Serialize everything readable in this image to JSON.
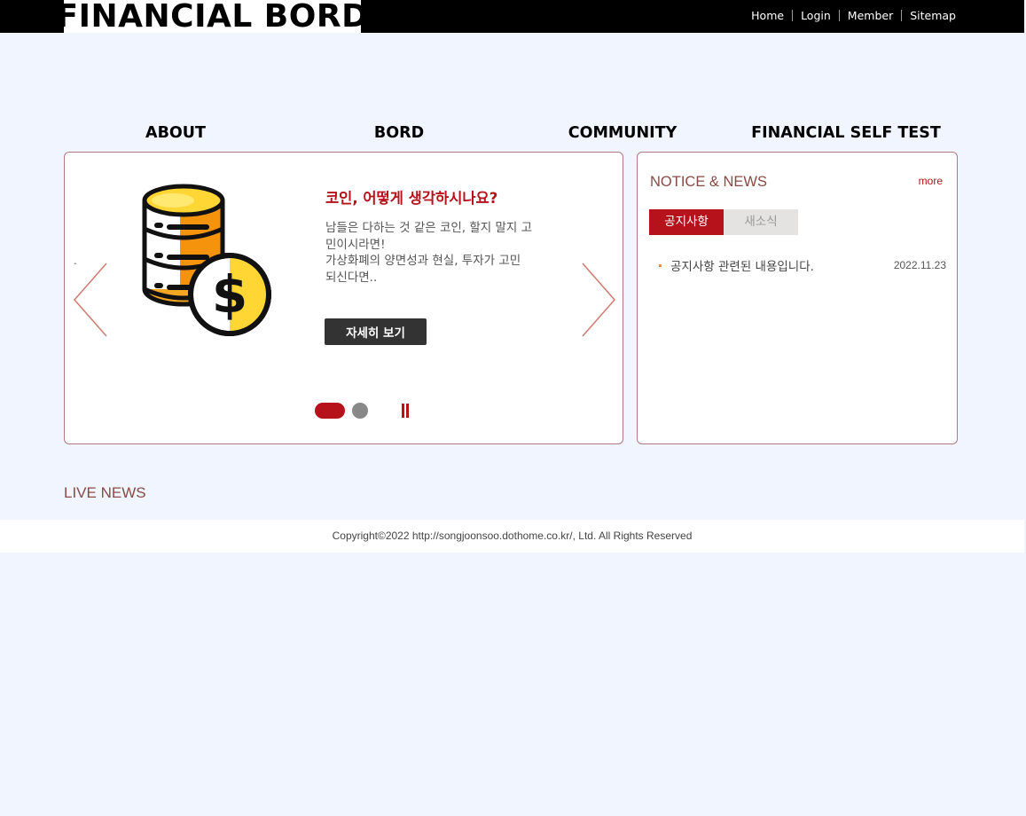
{
  "header": {
    "logo": "FINANCIAL BORD",
    "util_links": [
      "Home",
      "Login",
      "Member",
      "Sitemap"
    ]
  },
  "nav": [
    "ABOUT",
    "BORD",
    "COMMUNITY",
    "FINANCIAL SELF TEST"
  ],
  "slider": {
    "dash": "-",
    "title": "코인, 어떻게 생각하시나요?",
    "text_lines": [
      "남들은 다하는 것 같은 코인, 할지 말지 고",
      "민이시라면!",
      "가상화폐의 양면성과 현실, 투자가 고민",
      "되신다면.."
    ],
    "button": "자세히 보기",
    "image_icon": "coin-stack-dollar-icon",
    "slide_count": 2,
    "current_slide": 1,
    "colors": {
      "accent": "#b5121b",
      "dot_inactive": "#888888",
      "arrow": "#d07a70"
    }
  },
  "notice": {
    "title": "NOTICE & NEWS",
    "more": "more",
    "tabs": [
      {
        "label": "공지사항",
        "active": true
      },
      {
        "label": "새소식",
        "active": false
      }
    ],
    "items": [
      {
        "text": "공지사항 관련된 내용입니다.",
        "date": "2022.11.23"
      }
    ]
  },
  "live_news": {
    "title": "LIVE NEWS"
  },
  "footer": {
    "copyright": "Copyright©2022 http://songjoonsoo.dothome.co.kr/, Ltd. All Rights Reserved"
  }
}
